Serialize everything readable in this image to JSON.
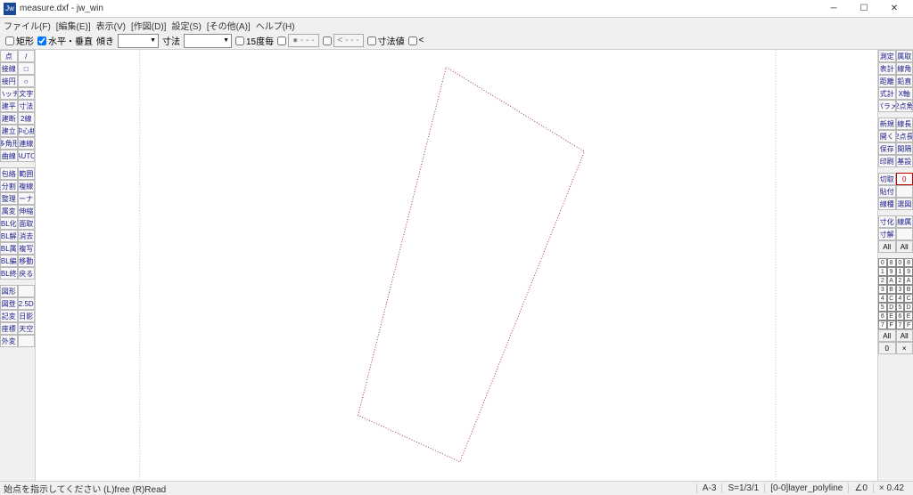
{
  "window": {
    "title": "measure.dxf - jw_win",
    "icon_label": "Jw"
  },
  "menu": {
    "file": "ファイル(F)",
    "edit": "[編集(E)]",
    "view": "表示(V)",
    "draw": "[作図(D)]",
    "settings": "設定(S)",
    "other": "[その他(A)]",
    "help": "ヘルプ(H)"
  },
  "opt": {
    "rect": "矩形",
    "hv": "水平・垂直",
    "incline": "傾き",
    "dim": "寸法",
    "deg15": "15度毎",
    "dimvalue": "寸法値",
    "lt": "<",
    "dash_btn": "- - -",
    "lt_btn": "< - - -"
  },
  "left_a": [
    "点",
    "接線",
    "接円",
    "ハッチ",
    "建平",
    "建断",
    "建立",
    "多角形",
    "曲線",
    "包絡",
    "分割",
    "整理",
    "属変",
    "BL化",
    "BL解",
    "BL属",
    "BL編",
    "BL終",
    "図形",
    "図登",
    "記変",
    "座標",
    "外変"
  ],
  "left_b": [
    "/",
    "□",
    "○",
    "文字",
    "寸法",
    "2線",
    "中心線",
    "連線",
    "AUTO",
    "範囲",
    "複線",
    "コーナー",
    "伸縮",
    "面取",
    "消去",
    "複写",
    "移動",
    "戻る",
    "",
    "2.5D",
    "日影",
    "天空"
  ],
  "right_a": [
    "測定",
    "表計",
    "距離",
    "式計",
    "パラメ",
    "新規",
    "開く",
    "保存",
    "印刷",
    "切取",
    "貼付",
    "線種",
    "寸化",
    "寸解"
  ],
  "right_b": [
    "属取",
    "線角",
    "鉛直",
    "X軸",
    "2点角",
    "線長",
    "2点長",
    "間隔",
    "基設",
    "",
    "",
    "",
    "選図",
    "線属"
  ],
  "right_all": "All",
  "right_zero": "0",
  "right_x": "×",
  "statusbar": {
    "prompt": "始点を指示してください (L)free (R)Read",
    "a": "A-3",
    "s": "S=1/3/1",
    "layer": "[0-0]layer_polyline",
    "angle": "∠0",
    "zoom": "× 0.42"
  }
}
